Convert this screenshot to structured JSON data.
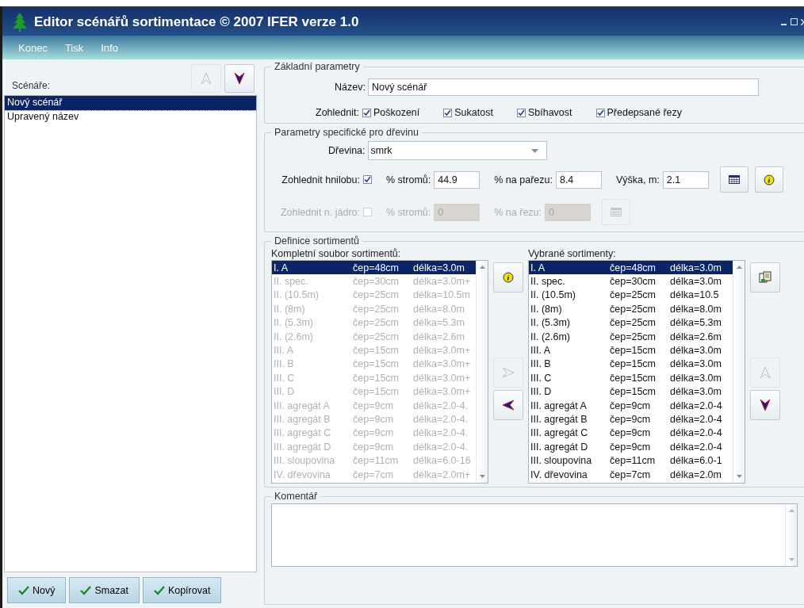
{
  "window": {
    "title": "Editor scénářů sortimentace © 2007 IFER verze 1.0"
  },
  "menu": [
    "Konec",
    "Tisk",
    "Info"
  ],
  "scenarios": {
    "label": "Scénáře:",
    "move_up": {
      "disabled": true
    },
    "move_down": {
      "disabled": false
    },
    "items": [
      {
        "label": "Nový scénář",
        "selected": true
      },
      {
        "label": "Upravený název",
        "selected": false
      }
    ],
    "buttons": [
      "Nový",
      "Smazat",
      "Kopírovat"
    ]
  },
  "basic": {
    "title": "Základní parametry",
    "name_label": "Název:",
    "name_value": "Nový scénář",
    "consider_label": "Zohlednit:",
    "options": [
      {
        "label": "Poškození",
        "checked": true
      },
      {
        "label": "Sukatost",
        "checked": true
      },
      {
        "label": "Sbíhavost",
        "checked": true
      },
      {
        "label": "Předepsané řezy",
        "checked": true
      }
    ]
  },
  "species": {
    "title": "Parametry specifické pro dřevinu",
    "species_label": "Dřevina:",
    "species_value": "smrk",
    "rows": [
      {
        "label": "Zohlednit hnilobu:",
        "checked": true,
        "disabled": false,
        "buttons": [
          {
            "kind": "calendar"
          },
          {
            "kind": "info"
          }
        ],
        "fields": [
          {
            "label": "% stromů:",
            "value": "44.9"
          },
          {
            "label": "% na pařezu:",
            "value": "8.4"
          },
          {
            "label": "Výška, m:",
            "value": "2.1"
          }
        ]
      },
      {
        "label": "Zohlednit n. jádro:",
        "checked": false,
        "disabled": true,
        "buttons": [
          {
            "kind": "calendar"
          }
        ],
        "fields": [
          {
            "label": "% stromů:",
            "value": "0"
          },
          {
            "label": "% na řezu:",
            "value": "0"
          }
        ]
      }
    ]
  },
  "definitions": {
    "title": "Definice sortimentů",
    "available": {
      "label": "Kompletní soubor sortimentů:",
      "disabled": true,
      "items": [
        {
          "name": "I. A",
          "diameter": "čep=48cm",
          "length": "délka=3.0m",
          "selected": true
        },
        {
          "name": "II. spec.",
          "diameter": "čep=30cm",
          "length": "délka=3.0m+",
          "selected": false
        },
        {
          "name": "II. (10.5m)",
          "diameter": "čep=25cm",
          "length": "délka=10.5m",
          "selected": false
        },
        {
          "name": "II. (8m)",
          "diameter": "čep=25cm",
          "length": "délka=8.0m",
          "selected": false
        },
        {
          "name": "II. (5.3m)",
          "diameter": "čep=25cm",
          "length": "délka=5.3m",
          "selected": false
        },
        {
          "name": "II. (2.6m)",
          "diameter": "čep=25cm",
          "length": "délka=2.6m",
          "selected": false
        },
        {
          "name": "III. A",
          "diameter": "čep=15cm",
          "length": "délka=3.0m+",
          "selected": false
        },
        {
          "name": "III. B",
          "diameter": "čep=15cm",
          "length": "délka=3.0m+",
          "selected": false
        },
        {
          "name": "III. C",
          "diameter": "čep=15cm",
          "length": "délka=3.0m+",
          "selected": false
        },
        {
          "name": "III. D",
          "diameter": "čep=15cm",
          "length": "délka=3.0m+",
          "selected": false
        },
        {
          "name": "III. agregát A",
          "diameter": "čep=9cm",
          "length": "délka=2.0-4.",
          "selected": false
        },
        {
          "name": "III. agregát B",
          "diameter": "čep=9cm",
          "length": "délka=2.0-4.",
          "selected": false
        },
        {
          "name": "III. agregát C",
          "diameter": "čep=9cm",
          "length": "délka=2.0-4.",
          "selected": false
        },
        {
          "name": "III. agregát D",
          "diameter": "čep=9cm",
          "length": "délka=2.0-4.",
          "selected": false
        },
        {
          "name": "III. sloupovina",
          "diameter": "čep=11cm",
          "length": "délka=6.0-16",
          "selected": false
        },
        {
          "name": "IV. dřevovina",
          "diameter": "čep=7cm",
          "length": "délka=2.0m+",
          "selected": false
        }
      ]
    },
    "add": {
      "disabled": true
    },
    "remove": {
      "disabled": false
    },
    "chosen": {
      "label": "Vybrané sortimenty:",
      "disabled": false,
      "items": [
        {
          "name": "I. A",
          "diameter": "čep=48cm",
          "length": "délka=3.0m",
          "selected": true
        },
        {
          "name": "II. spec.",
          "diameter": "čep=30cm",
          "length": "délka=3.0m",
          "selected": false
        },
        {
          "name": "II. (10.5m)",
          "diameter": "čep=25cm",
          "length": "délka=10.5",
          "selected": false
        },
        {
          "name": "II. (8m)",
          "diameter": "čep=25cm",
          "length": "délka=8.0m",
          "selected": false
        },
        {
          "name": "II. (5.3m)",
          "diameter": "čep=25cm",
          "length": "délka=5.3m",
          "selected": false
        },
        {
          "name": "II. (2.6m)",
          "diameter": "čep=25cm",
          "length": "délka=2.6m",
          "selected": false
        },
        {
          "name": "III. A",
          "diameter": "čep=15cm",
          "length": "délka=3.0m",
          "selected": false
        },
        {
          "name": "III. B",
          "diameter": "čep=15cm",
          "length": "délka=3.0m",
          "selected": false
        },
        {
          "name": "III. C",
          "diameter": "čep=15cm",
          "length": "délka=3.0m",
          "selected": false
        },
        {
          "name": "III. D",
          "diameter": "čep=15cm",
          "length": "délka=3.0m",
          "selected": false
        },
        {
          "name": "III. agregát A",
          "diameter": "čep=9cm",
          "length": "délka=2.0-4",
          "selected": false
        },
        {
          "name": "III. agregát B",
          "diameter": "čep=9cm",
          "length": "délka=2.0-4",
          "selected": false
        },
        {
          "name": "III. agregát C",
          "diameter": "čep=9cm",
          "length": "délka=2.0-4",
          "selected": false
        },
        {
          "name": "III. agregát D",
          "diameter": "čep=9cm",
          "length": "délka=2.0-4",
          "selected": false
        },
        {
          "name": "III. sloupovina",
          "diameter": "čep=11cm",
          "length": "délka=6.0-1",
          "selected": false
        },
        {
          "name": "IV. dřevovina",
          "diameter": "čep=7cm",
          "length": "délka=2.0m",
          "selected": false
        }
      ]
    },
    "move_up": {
      "disabled": true
    },
    "move_down": {
      "disabled": false
    }
  },
  "comment": {
    "title": "Komentář"
  }
}
